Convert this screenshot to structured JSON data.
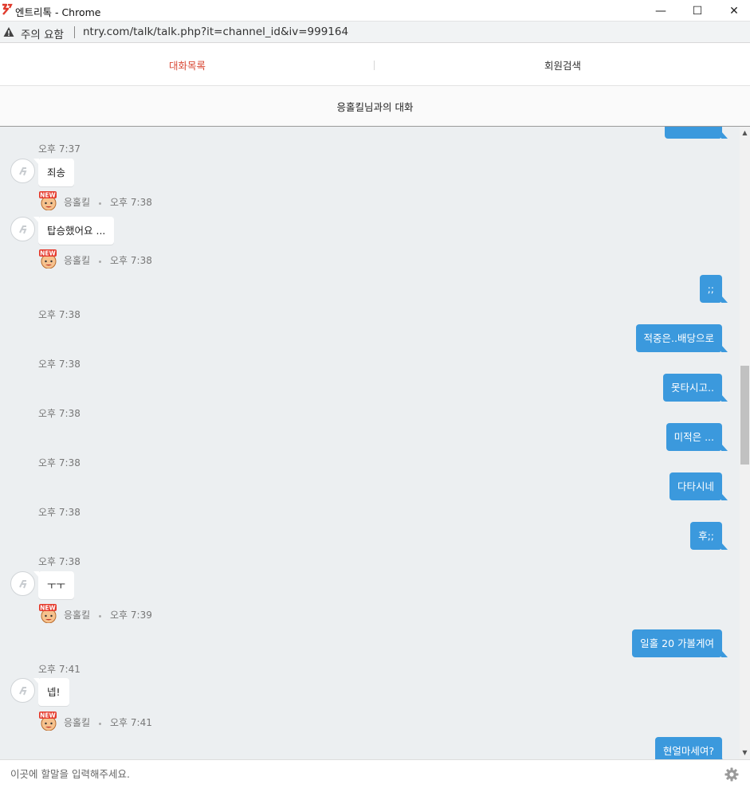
{
  "window": {
    "title": "엔트리톡 - Chrome",
    "minimize": "—",
    "maximize": "☐",
    "close": "✕"
  },
  "address": {
    "security_label": "주의 요함",
    "url": "ntry.com/talk/talk.php?it=channel_id&iv=999164"
  },
  "tabs": [
    {
      "label": "대화목록",
      "active": true
    },
    {
      "label": "회원검색",
      "active": false
    }
  ],
  "conversation": {
    "title": "응홀킬님과의 대화"
  },
  "messages": [
    {
      "type": "time",
      "text": "오후 7:37"
    },
    {
      "type": "in",
      "text": "죄송"
    },
    {
      "type": "sender",
      "name": "응홀킬",
      "time": "오후 7:38"
    },
    {
      "type": "in",
      "text": "탑승했어요 ..."
    },
    {
      "type": "sender",
      "name": "응홀킬",
      "time": "오후 7:38"
    },
    {
      "type": "out",
      "text": ";;"
    },
    {
      "type": "time",
      "text": "오후 7:38"
    },
    {
      "type": "out",
      "text": "적중은..배당으로"
    },
    {
      "type": "time",
      "text": "오후 7:38"
    },
    {
      "type": "out",
      "text": "못타시고.."
    },
    {
      "type": "time",
      "text": "오후 7:38"
    },
    {
      "type": "out",
      "text": "미적은 ..."
    },
    {
      "type": "time",
      "text": "오후 7:38"
    },
    {
      "type": "out",
      "text": "다타시네"
    },
    {
      "type": "time",
      "text": "오후 7:38"
    },
    {
      "type": "out",
      "text": "후;;"
    },
    {
      "type": "time",
      "text": "오후 7:38"
    },
    {
      "type": "in",
      "text": "ㅜㅜ"
    },
    {
      "type": "sender",
      "name": "응홀킬",
      "time": "오후 7:39"
    },
    {
      "type": "out",
      "text": "일홀 20 가볼게여"
    },
    {
      "type": "time",
      "text": "오후 7:41"
    },
    {
      "type": "in",
      "text": "넵!"
    },
    {
      "type": "sender",
      "name": "응홀킬",
      "time": "오후 7:41"
    },
    {
      "type": "out",
      "text": "현얼마세여?"
    }
  ],
  "input": {
    "placeholder": "이곳에 할말을 입력해주세요.",
    "value": ""
  },
  "icons": {
    "window_logo": "entry-logo-icon",
    "security": "warning-triangle-icon",
    "avatar": "default-avatar-icon",
    "badge": "new-badge-icon",
    "settings": "gear-icon"
  },
  "colors": {
    "active_tab": "#d94a36",
    "outgoing_bubble": "#3b99dd",
    "chat_background": "#eceff1"
  }
}
